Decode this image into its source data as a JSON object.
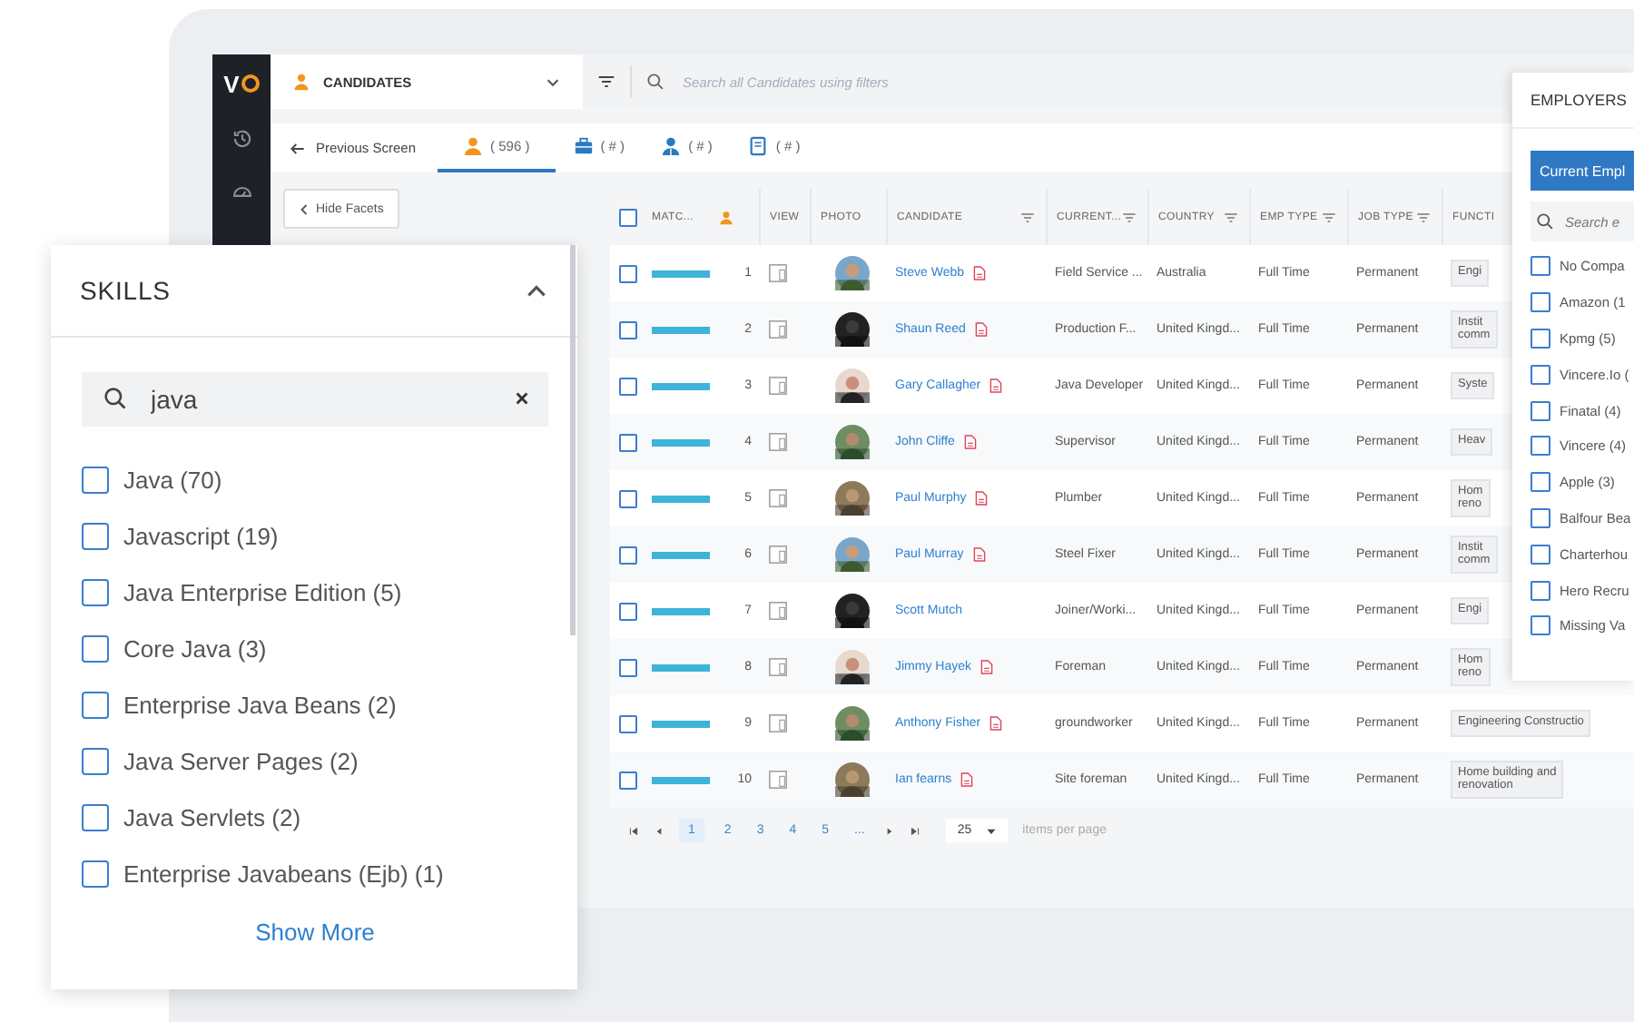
{
  "sidebar": {
    "logo": "V"
  },
  "module_selector": {
    "label": "CANDIDATES"
  },
  "search": {
    "placeholder": "Search all Candidates using filters"
  },
  "back_link": "Previous Screen",
  "tabs": [
    {
      "kind": "candidates",
      "label": "( 596 )",
      "selected": true
    },
    {
      "kind": "jobs",
      "label": "( # )",
      "selected": false
    },
    {
      "kind": "contacts",
      "label": "( # )",
      "selected": false
    },
    {
      "kind": "documents",
      "label": "( # )",
      "selected": false
    }
  ],
  "hide_facets": "Hide Facets",
  "table": {
    "select_all_checked": false,
    "columns": [
      {
        "label": "MATC...",
        "filter": false
      },
      {
        "label": "VIEW",
        "filter": false
      },
      {
        "label": "PHOTO",
        "filter": false
      },
      {
        "label": "CANDIDATE",
        "filter": true
      },
      {
        "label": "CURRENT...",
        "filter": true
      },
      {
        "label": "COUNTRY",
        "filter": true
      },
      {
        "label": "EMP TYPE",
        "filter": true
      },
      {
        "label": "JOB TYPE",
        "filter": true
      },
      {
        "label": "FUNCTI",
        "filter": false
      }
    ],
    "rows": [
      {
        "checked": false,
        "level": 1,
        "number": "1",
        "name": "Steve Webb",
        "resume": true,
        "current": "Field Service ...",
        "country": "Australia",
        "emp_type": "Full Time",
        "job_type": "Permanent",
        "function": "Engi"
      },
      {
        "checked": false,
        "level": 1,
        "number": "2",
        "name": "Shaun Reed",
        "resume": true,
        "current": "Production F...",
        "country": "United Kingd...",
        "emp_type": "Full Time",
        "job_type": "Permanent",
        "function": "Instit\ncomm"
      },
      {
        "checked": false,
        "level": 1,
        "number": "3",
        "name": "Gary Callagher",
        "resume": true,
        "current": "Java Developer",
        "country": "United Kingd...",
        "emp_type": "Full Time",
        "job_type": "Permanent",
        "function": "Syste"
      },
      {
        "checked": false,
        "level": 1,
        "number": "4",
        "name": "John Cliffe",
        "resume": true,
        "current": "Supervisor",
        "country": "United Kingd...",
        "emp_type": "Full Time",
        "job_type": "Permanent",
        "function": "Heav"
      },
      {
        "checked": false,
        "level": 1,
        "number": "5",
        "name": "Paul Murphy",
        "resume": true,
        "current": "Plumber",
        "country": "United Kingd...",
        "emp_type": "Full Time",
        "job_type": "Permanent",
        "function": "Hom\nreno"
      },
      {
        "checked": false,
        "level": 1,
        "number": "6",
        "name": "Paul Murray",
        "resume": true,
        "current": "Steel Fixer",
        "country": "United Kingd...",
        "emp_type": "Full Time",
        "job_type": "Permanent",
        "function": "Instit\ncomm"
      },
      {
        "checked": false,
        "level": 1,
        "number": "7",
        "name": "Scott Mutch",
        "resume": false,
        "current": "Joiner/Worki...",
        "country": "United Kingd...",
        "emp_type": "Full Time",
        "job_type": "Permanent",
        "function": "Engi"
      },
      {
        "checked": false,
        "level": 1,
        "number": "8",
        "name": "Jimmy Hayek",
        "resume": true,
        "current": "Foreman",
        "country": "United Kingd...",
        "emp_type": "Full Time",
        "job_type": "Permanent",
        "function": "Hom\nreno"
      },
      {
        "checked": false,
        "level": 1,
        "number": "9",
        "name": "Anthony Fisher",
        "resume": true,
        "current": "groundworker",
        "country": "United Kingd...",
        "emp_type": "Full Time",
        "job_type": "Permanent",
        "function": "Engineering Constructio"
      },
      {
        "checked": false,
        "level": 1,
        "number": "10",
        "name": "Ian fearns",
        "resume": true,
        "current": "Site foreman",
        "country": "United Kingd...",
        "emp_type": "Full Time",
        "job_type": "Permanent",
        "function": "Home building and\nrenovation"
      }
    ]
  },
  "pagination": {
    "pages": [
      {
        "label": "1",
        "selected": true
      },
      {
        "label": "2",
        "selected": false
      },
      {
        "label": "3",
        "selected": false
      },
      {
        "label": "4",
        "selected": false
      },
      {
        "label": "5",
        "selected": false
      }
    ],
    "ellipsis": "...",
    "page_size": "25",
    "page_size_label": "items per page"
  },
  "skills": {
    "title": "SKILLS",
    "expanded": true,
    "search_value": "java",
    "items": [
      {
        "label": "Java (70)",
        "checked": false
      },
      {
        "label": "Javascript (19)",
        "checked": false
      },
      {
        "label": "Java Enterprise Edition (5)",
        "checked": false
      },
      {
        "label": "Core Java (3)",
        "checked": false
      },
      {
        "label": "Enterprise Java Beans (2)",
        "checked": false
      },
      {
        "label": "Java Server Pages (2)",
        "checked": false
      },
      {
        "label": "Java Servlets (2)",
        "checked": false
      },
      {
        "label": "Enterprise Javabeans (Ejb) (1)",
        "checked": false
      }
    ],
    "show_more": "Show More"
  },
  "employers": {
    "title": "EMPLOYERS",
    "button": "Current Empl",
    "search_placeholder": "Search e",
    "items": [
      {
        "label": "No Compa",
        "checked": false
      },
      {
        "label": "Amazon (1",
        "checked": false
      },
      {
        "label": "Kpmg (5)",
        "checked": false
      },
      {
        "label": "Vincere.Io (",
        "checked": false
      },
      {
        "label": "Finatal (4)",
        "checked": false
      },
      {
        "label": "Vincere (4)",
        "checked": false
      },
      {
        "label": "Apple (3)",
        "checked": false
      },
      {
        "label": "Balfour Bea",
        "checked": false
      },
      {
        "label": "Charterhou",
        "checked": false
      },
      {
        "label": "Hero Recru",
        "checked": false
      },
      {
        "label": "Missing Va",
        "checked": false
      }
    ]
  }
}
